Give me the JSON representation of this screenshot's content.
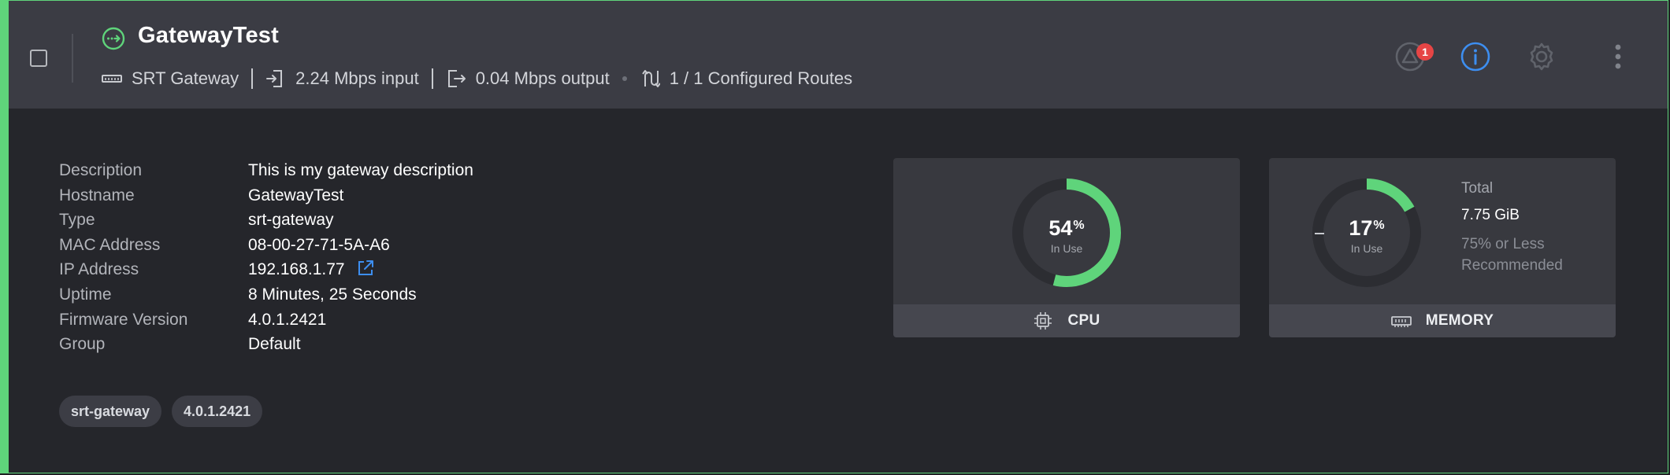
{
  "header": {
    "title": "GatewayTest",
    "type_label": "SRT Gateway",
    "input_label": "2.24 Mbps input",
    "output_label": "0.04 Mbps output",
    "routes_label": "1 / 1 Configured Routes",
    "alerts_count": "1",
    "icons": [
      "gateway-icon",
      "device-icon",
      "input-icon",
      "output-icon",
      "routes-icon",
      "alert-icon",
      "info-icon",
      "gear-icon",
      "more-vertical-icon"
    ]
  },
  "details": [
    {
      "key": "Description",
      "value": "This is my gateway description"
    },
    {
      "key": "Hostname",
      "value": "GatewayTest"
    },
    {
      "key": "Type",
      "value": "srt-gateway"
    },
    {
      "key": "MAC Address",
      "value": "08-00-27-71-5A-A6"
    },
    {
      "key": "IP Address",
      "value": "192.168.1.77"
    },
    {
      "key": "Uptime",
      "value": "8 Minutes, 25 Seconds"
    },
    {
      "key": "Firmware Version",
      "value": "4.0.1.2421"
    },
    {
      "key": "Group",
      "value": "Default"
    }
  ],
  "tags": [
    "srt-gateway",
    "4.0.1.2421"
  ],
  "cpu": {
    "percent": 54,
    "percent_text": "54",
    "percent_sign": "%",
    "sub": "In Use",
    "label": "CPU"
  },
  "memory": {
    "percent": 17,
    "percent_text": "17",
    "percent_sign": "%",
    "sub": "In Use",
    "label": "MEMORY",
    "total_label": "Total",
    "total_value": "7.75 GiB",
    "recommend_line1": "75% or Less",
    "recommend_line2": "Recommended"
  },
  "colors": {
    "accent_green": "#5fd47b",
    "info_blue": "#3d8ef0",
    "alert_red": "#e64545",
    "header_bg": "#3b3c44",
    "body_bg": "#25262b"
  }
}
